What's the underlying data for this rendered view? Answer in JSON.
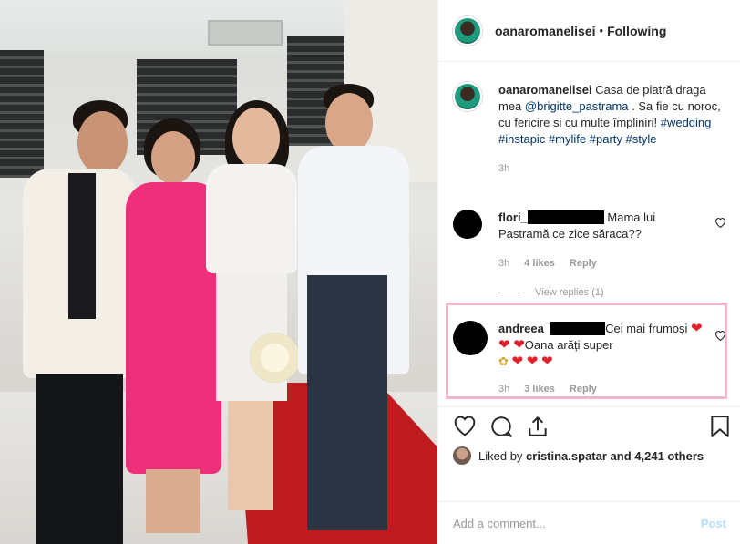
{
  "header": {
    "username": "oanaromanelisei",
    "separator": "•",
    "follow_status": "Following"
  },
  "caption": {
    "username": "oanaromanelisei",
    "text_before": "Casa de piatră draga mea ",
    "mention": "@brigitte_pastrama",
    "text_after": " . Sa fie cu noroc, cu fericire si cu multe împliniri! ",
    "hashtags": [
      "#wedding",
      "#instapic",
      "#mylife",
      "#party",
      "#style"
    ],
    "time": "3h"
  },
  "comments": [
    {
      "username": "flori_",
      "text": "Mama lui Pastramă ce zice săraca??",
      "time": "3h",
      "likes": "4 likes",
      "reply": "Reply"
    },
    {
      "username": "andreea_",
      "text_a": "Cei mai frumoși",
      "text_b": "Oana arăți super",
      "time": "3h",
      "likes": "3 likes",
      "reply": "Reply"
    }
  ],
  "view_replies": "View replies (1)",
  "likes": {
    "prefix": "Liked by ",
    "user": "cristina.spatar",
    "suffix": " and 4,241 others"
  },
  "add_comment": {
    "placeholder": "Add a comment...",
    "post": "Post"
  },
  "icons": [
    "heart-icon",
    "comment-icon",
    "share-icon",
    "bookmark-icon"
  ],
  "colors": {
    "link": "#003569",
    "post_disabled": "#b2dffc",
    "highlight": "#f2b6c9"
  }
}
